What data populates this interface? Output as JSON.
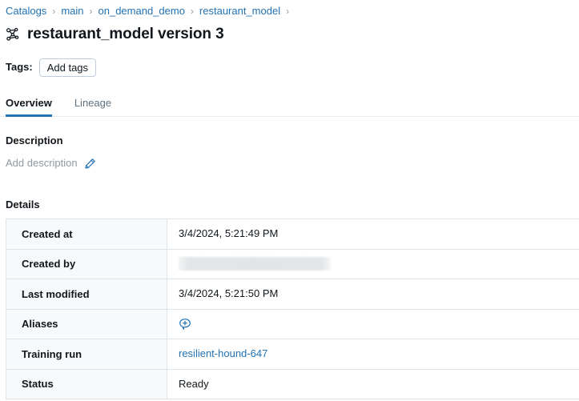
{
  "breadcrumb": {
    "separator": "›",
    "items": [
      {
        "label": "Catalogs"
      },
      {
        "label": "main"
      },
      {
        "label": "on_demand_demo"
      },
      {
        "label": "restaurant_model"
      }
    ],
    "trailing_separator": "›"
  },
  "header": {
    "icon": "model-graph-icon",
    "title": "restaurant_model version 3"
  },
  "tags": {
    "label": "Tags:",
    "add_button_label": "Add tags"
  },
  "tabs": [
    {
      "label": "Overview",
      "active": true
    },
    {
      "label": "Lineage",
      "active": false
    }
  ],
  "description": {
    "heading": "Description",
    "placeholder": "Add description",
    "edit_icon": "pencil-icon"
  },
  "details": {
    "heading": "Details",
    "rows": [
      {
        "key": "Created at",
        "value": "3/4/2024, 5:21:49 PM",
        "type": "text"
      },
      {
        "key": "Created by",
        "value": "",
        "type": "redacted"
      },
      {
        "key": "Last modified",
        "value": "3/4/2024, 5:21:50 PM",
        "type": "text"
      },
      {
        "key": "Aliases",
        "value": "",
        "type": "icon",
        "icon": "add-alias-tag-icon"
      },
      {
        "key": "Training run",
        "value": "resilient-hound-647",
        "type": "link"
      },
      {
        "key": "Status",
        "value": "Ready",
        "type": "text"
      }
    ]
  },
  "colors": {
    "link": "#2272b4",
    "accent": "#2272b4",
    "text": "#11171c",
    "muted": "#5f7281",
    "placeholder": "#8f98a3",
    "border": "#dce4ea",
    "key_cell_bg": "#f8f9fa",
    "tab_border": "#e4ecf1"
  }
}
